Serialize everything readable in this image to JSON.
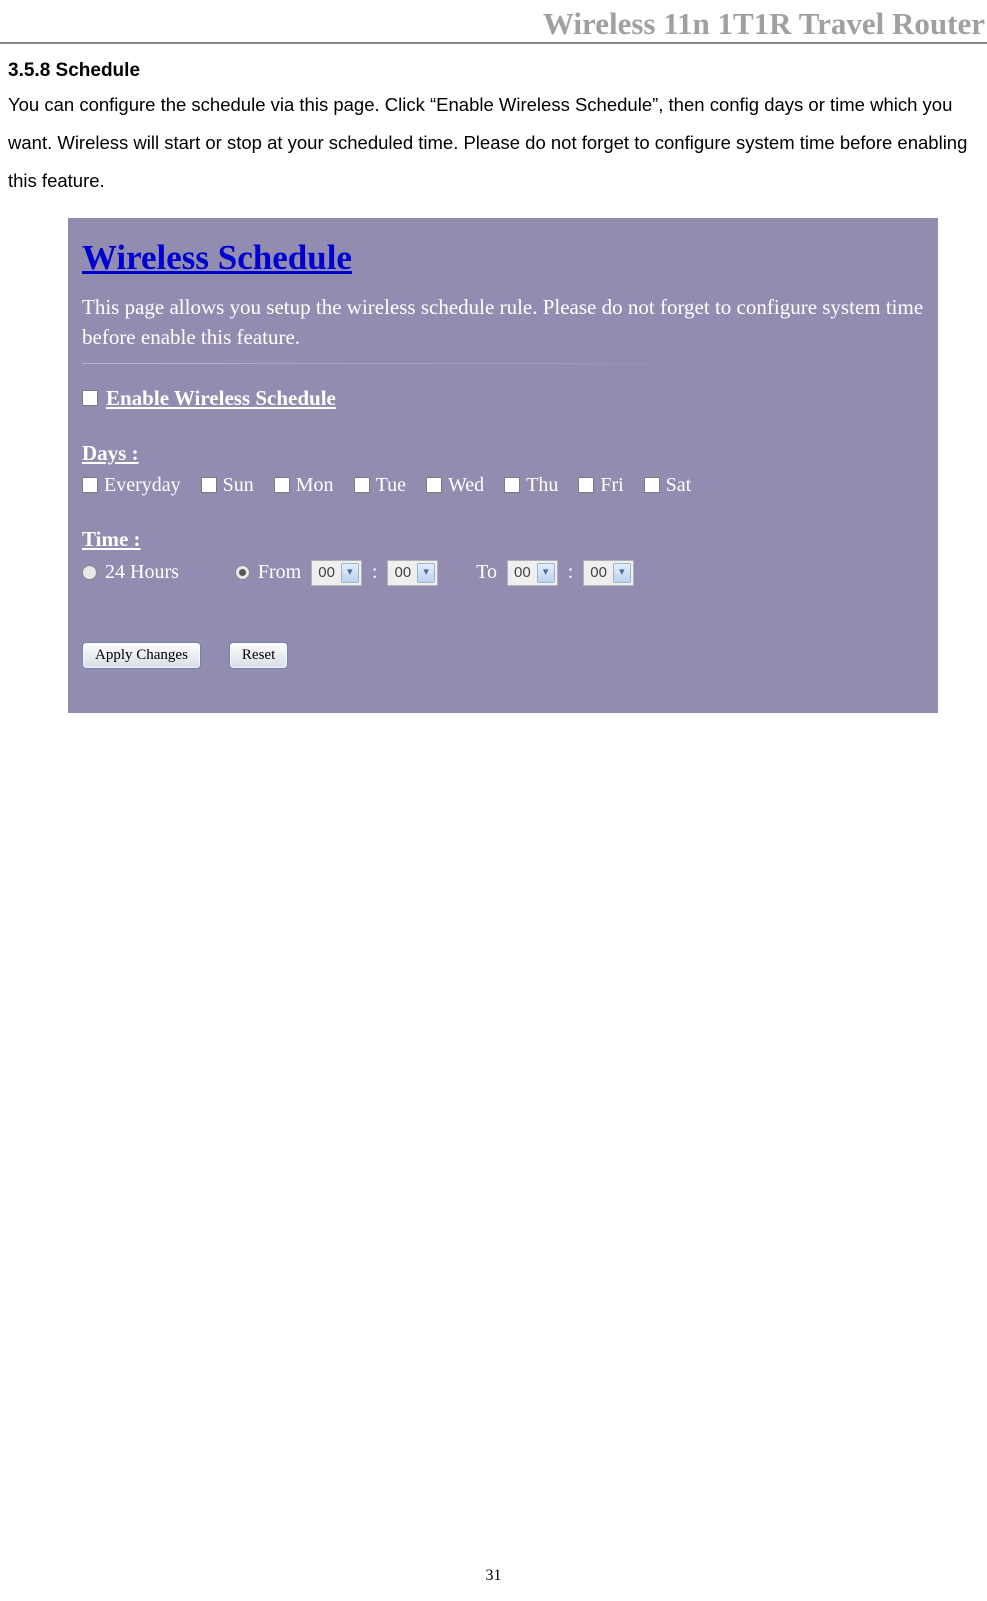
{
  "header": {
    "product_title": "Wireless 11n 1T1R Travel Router"
  },
  "section": {
    "number_title": "3.5.8   Schedule",
    "body": "You can configure the schedule via this page. Click “Enable Wireless Schedule”, then config days or time which you want. Wireless will start or stop at your scheduled time. Please do not forget to configure system time before enabling this feature."
  },
  "panel": {
    "title": "Wireless Schedule",
    "description": "This page allows you setup the wireless schedule rule. Please do not forget to configure system time before enable this feature.",
    "enable_label": "Enable Wireless Schedule",
    "days_label": "Days :",
    "days": {
      "everyday": "Everyday",
      "sun": "Sun",
      "mon": "Mon",
      "tue": "Tue",
      "wed": "Wed",
      "thu": "Thu",
      "fri": "Fri",
      "sat": "Sat"
    },
    "time_label": "Time :",
    "time": {
      "all_day": "24 Hours",
      "from_label": "From",
      "to_label": "To",
      "from_h": "00",
      "from_m": "00",
      "to_h": "00",
      "to_m": "00"
    },
    "buttons": {
      "apply": "Apply Changes",
      "reset": "Reset"
    }
  },
  "page_number": "31"
}
